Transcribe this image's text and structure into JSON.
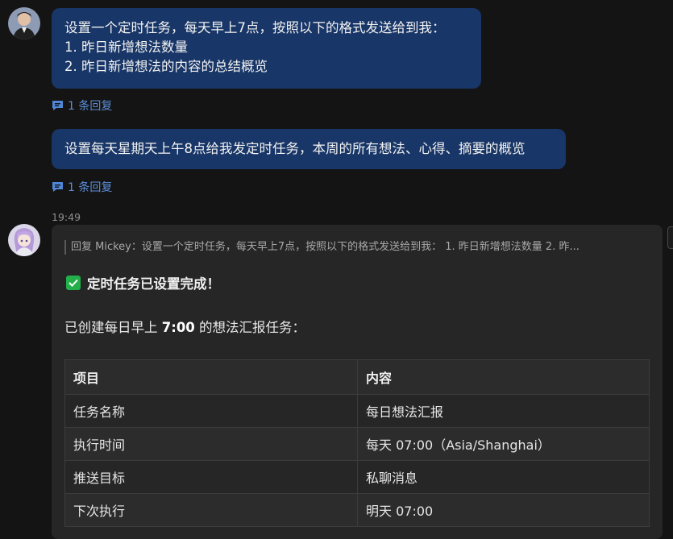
{
  "messages": [
    {
      "lines": [
        "设置一个定时任务，每天早上7点，按照以下的格式发送给到我：",
        "1. 昨日新增想法数量",
        "2. 昨日新增想法的内容的总结概览"
      ],
      "reply_label": "1 条回复"
    },
    {
      "lines": [
        "设置每天星期天上午8点给我发定时任务，本周的所有想法、心得、摘要的概览"
      ],
      "reply_label": "1 条回复"
    }
  ],
  "bot_message": {
    "timestamp": "19:49",
    "quote": "回复 Mickey：设置一个定时任务，每天早上7点，按照以下的格式发送给到我： 1. 昨日新增想法数量 2. 昨...",
    "status": "定时任务已设置完成！",
    "intro_prefix": "已创建每日早上 ",
    "intro_bold": "7:00",
    "intro_suffix": " 的想法汇报任务：",
    "table": {
      "headers": [
        "项目",
        "内容"
      ],
      "rows": [
        [
          "任务名称",
          "每日想法汇报"
        ],
        [
          "执行时间",
          "每天 07:00（Asia/Shanghai）"
        ],
        [
          "推送目标",
          "私聊消息"
        ],
        [
          "下次执行",
          "明天 07:00"
        ]
      ]
    }
  },
  "colors": {
    "background": "#141414",
    "bubble": "#183667",
    "link": "#5b8ed8",
    "check": "#23b04a"
  },
  "icons": [
    "reply-comment-icon",
    "check-icon"
  ]
}
